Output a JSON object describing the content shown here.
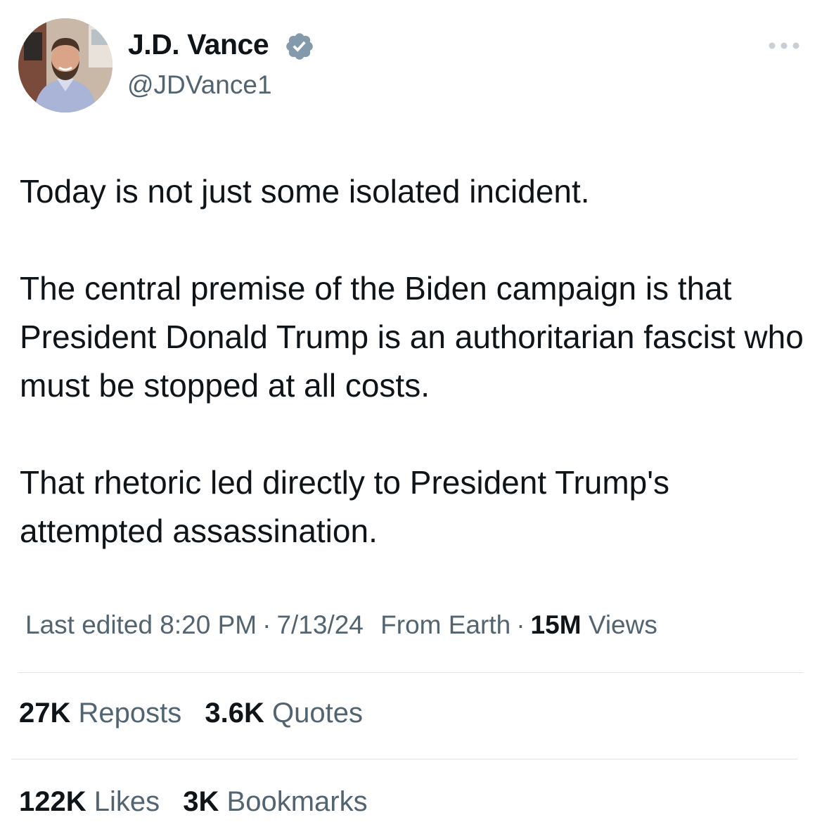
{
  "author": {
    "display_name": "J.D. Vance",
    "handle": "@JDVance1",
    "verified_color": "#829aab",
    "avatar_icon": "profile-photo"
  },
  "tweet": {
    "paragraphs": [
      "Today is not just some isolated incident.",
      "The central premise of the Biden campaign is that President Donald Trump is an authoritarian fascist who must be stopped at all costs.",
      "That rhetoric led directly to President Trump's attempted assassination."
    ]
  },
  "meta": {
    "edited": "Last edited 8:20 PM",
    "date": "7/13/24",
    "source": "From Earth",
    "views_count": "15M",
    "views_label": "Views"
  },
  "stats": {
    "reposts": {
      "count": "27K",
      "label": "Reposts"
    },
    "quotes": {
      "count": "3.6K",
      "label": "Quotes"
    },
    "likes": {
      "count": "122K",
      "label": "Likes"
    },
    "bookmarks": {
      "count": "3K",
      "label": "Bookmarks"
    }
  },
  "colors": {
    "text_primary": "#0f1419",
    "text_secondary": "#536471",
    "divider": "#dfe3e6"
  }
}
